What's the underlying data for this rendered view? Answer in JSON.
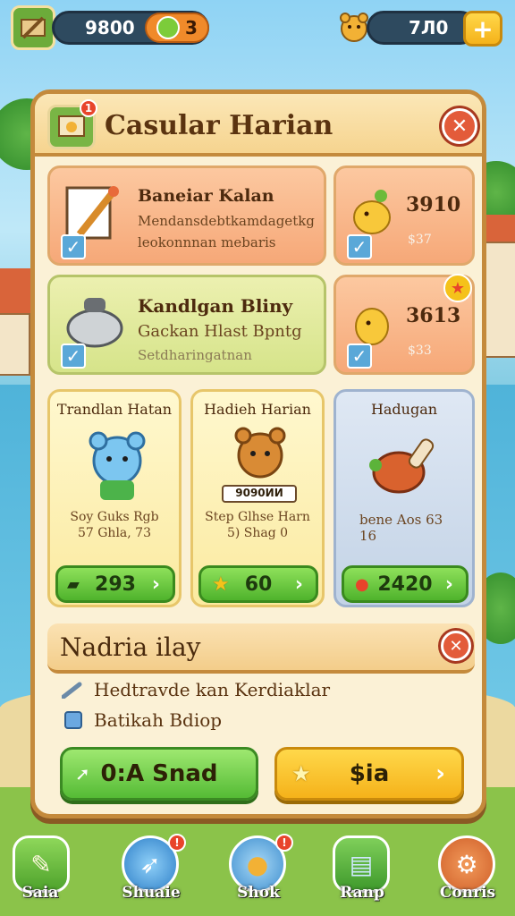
{
  "topbar": {
    "coins": "9800",
    "level": "3",
    "gems": "7Л0",
    "add_symbol": "+"
  },
  "panel": {
    "title": "Casular Harian",
    "close_symbol": "✕",
    "tasks": [
      {
        "title": "Baneiar Kalan",
        "line1": "Mendansdebtkamdagetkg",
        "line2": "leokonnnan mebaris",
        "reward": "3910",
        "sub": "$37"
      },
      {
        "title": "Kandlgan Bliny",
        "line1": "Gackan Hlast Bpntg",
        "line2": "Setdharingatnan",
        "reward": "3613",
        "sub": "$33"
      }
    ],
    "rewards": [
      {
        "title": "Trandlan Hatan",
        "line1": "Soy Guks Rgb",
        "line2": "57 Ghla, 73",
        "button": "293"
      },
      {
        "title": "Hadieh Harian",
        "tag": "9090ИИ",
        "line1": "Step Glhse Harn",
        "line2": "5) Shag 0",
        "button": "60"
      },
      {
        "title": "Hadugan",
        "line1": "bene Aos 63",
        "line2": "16",
        "button": "2420"
      }
    ],
    "section": {
      "title": "Nadria ilay",
      "close_symbol": "✕",
      "lines": [
        "Hedtravde kan Kerdiaklar",
        "Batikah Bdiop"
      ]
    },
    "buttons": {
      "left": "0:A Snad",
      "right": "$ia"
    }
  },
  "nav": [
    {
      "label": "Saia"
    },
    {
      "label": "Shuaie"
    },
    {
      "label": "Shok"
    },
    {
      "label": "Ranp"
    },
    {
      "label": "Conris"
    }
  ],
  "colors": {
    "panel_border": "#c48a3c",
    "accent_green": "#55bb35",
    "accent_yellow": "#f5b21a",
    "close_red": "#e35b3a"
  }
}
